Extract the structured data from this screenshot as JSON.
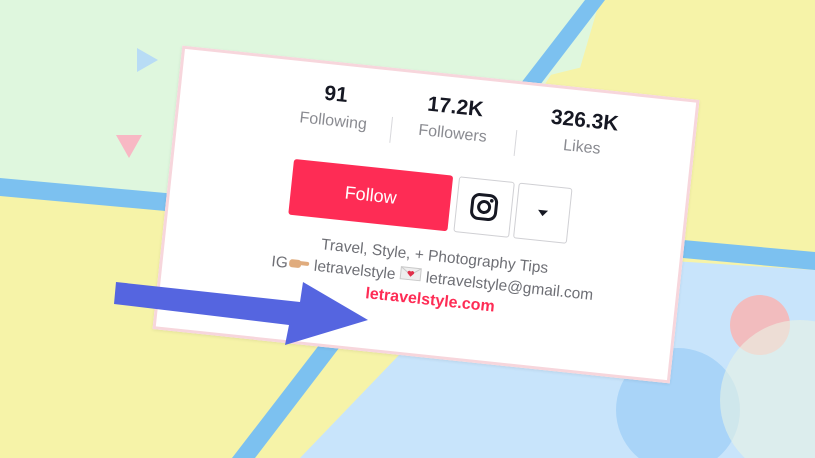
{
  "colors": {
    "accent": "#fe2c55",
    "arrow": "#5565e0",
    "bg_green": "#dff7de",
    "bg_yellow": "#f6f3a8",
    "bg_blue": "#c8e4fb",
    "stripe_blue": "#7cc1f0"
  },
  "stats": [
    {
      "value": "91",
      "label": "Following"
    },
    {
      "value": "17.2K",
      "label": "Followers"
    },
    {
      "value": "326.3K",
      "label": "Likes"
    }
  ],
  "buttons": {
    "follow_label": "Follow",
    "instagram_icon": "instagram-icon",
    "more_icon": "caret-down-icon"
  },
  "bio": {
    "line1": "Travel, Style, + Photography Tips",
    "line2_prefix": "IG",
    "line2_handle": "letravelstyle",
    "line2_email": "letravelstyle@gmail.com",
    "link": "letravelstyle.com"
  }
}
